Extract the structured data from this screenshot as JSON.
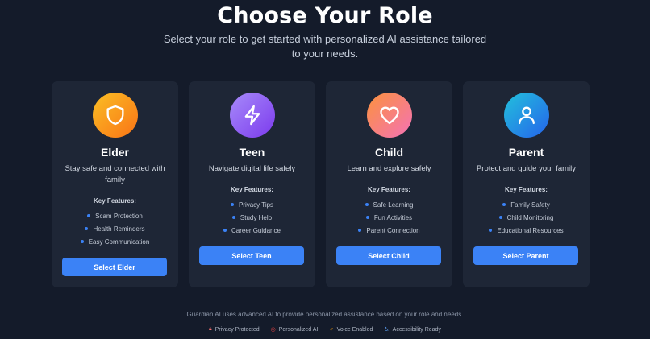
{
  "header": {
    "title": "Choose Your Role",
    "subtitle": "Select your role to get started with personalized AI assistance tailored to your needs."
  },
  "features_label": "Key Features:",
  "roles": [
    {
      "name": "Elder",
      "description": "Stay safe and connected with family",
      "features": [
        "Scam Protection",
        "Health Reminders",
        "Easy Communication"
      ],
      "button": "Select Elder",
      "icon": "shield-icon",
      "color": "#f59e0b"
    },
    {
      "name": "Teen",
      "description": "Navigate digital life safely",
      "features": [
        "Privacy Tips",
        "Study Help",
        "Career Guidance"
      ],
      "button": "Select Teen",
      "icon": "lightning-icon",
      "color": "#8b5cf6"
    },
    {
      "name": "Child",
      "description": "Learn and explore safely",
      "features": [
        "Safe Learning",
        "Fun Activities",
        "Parent Connection"
      ],
      "button": "Select Child",
      "icon": "heart-icon",
      "color": "#f87171"
    },
    {
      "name": "Parent",
      "description": "Protect and guide your family",
      "features": [
        "Family Safety",
        "Child Monitoring",
        "Educational Resources"
      ],
      "button": "Select Parent",
      "icon": "user-icon",
      "color": "#0ea5c9"
    }
  ],
  "footer": {
    "text": "Guardian AI uses advanced AI to provide personalized assistance based on your role and needs.",
    "badges": [
      {
        "label": "Privacy Protected",
        "icon": "lock-icon"
      },
      {
        "label": "Personalized AI",
        "icon": "target-icon"
      },
      {
        "label": "Voice Enabled",
        "icon": "microphone-icon"
      },
      {
        "label": "Accessibility Ready",
        "icon": "accessibility-icon"
      }
    ]
  },
  "colors": {
    "background": "#141b2a",
    "card": "#1e2636",
    "accent": "#3b82f6"
  }
}
